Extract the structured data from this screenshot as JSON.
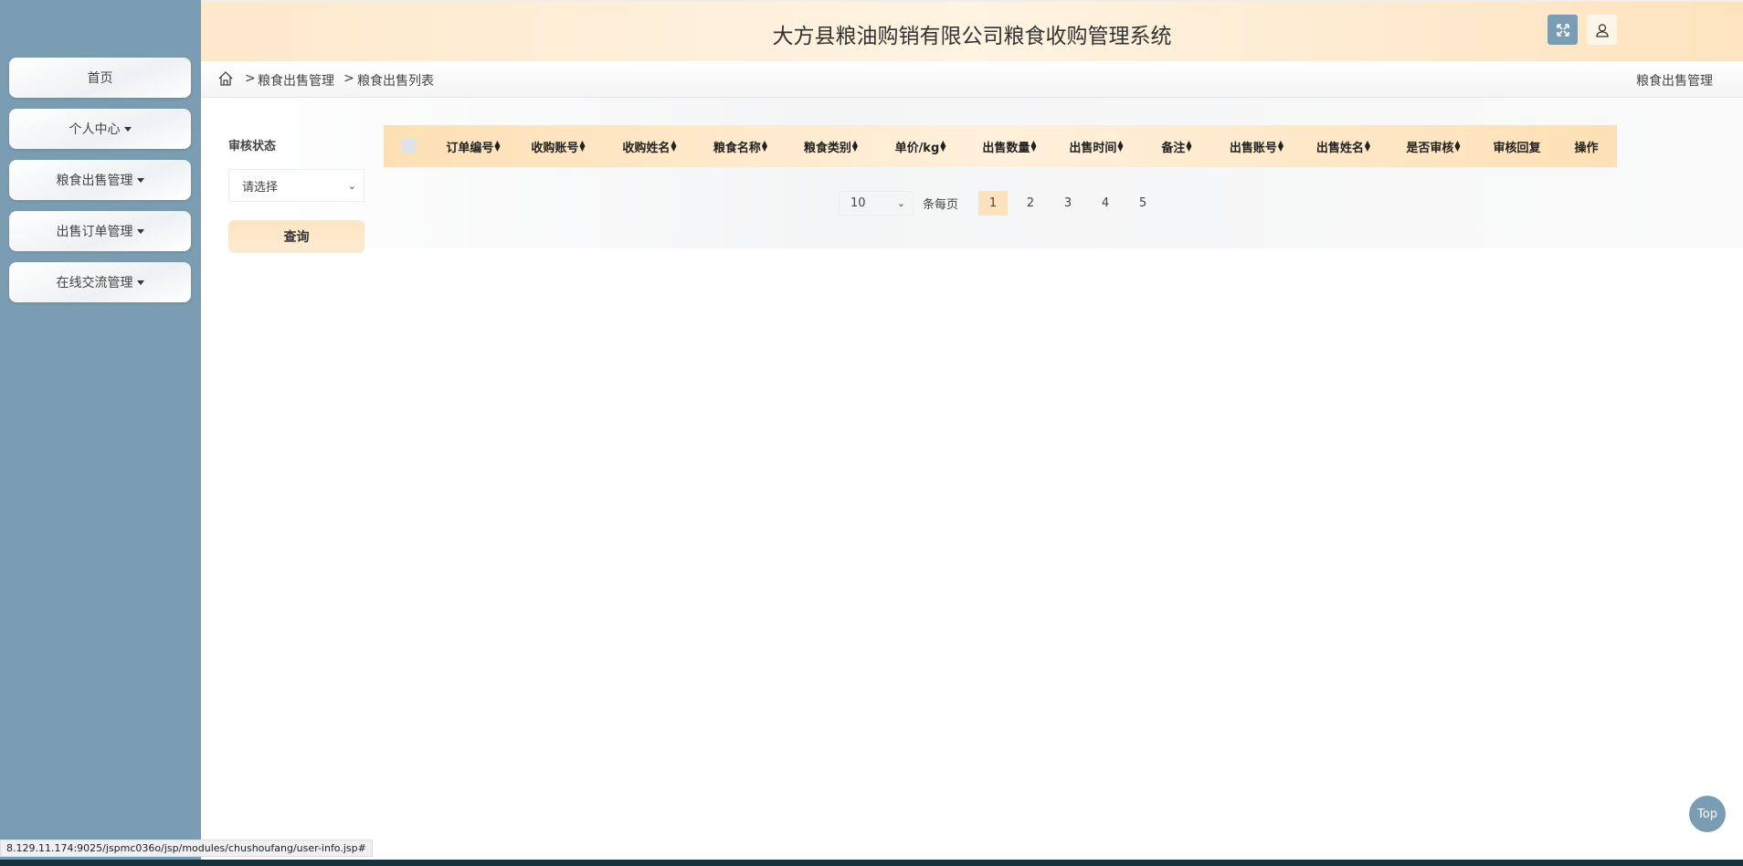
{
  "header": {
    "title": "大方县粮油购销有限公司粮食收购管理系统"
  },
  "sidebar": {
    "items": [
      {
        "label": "首页",
        "dropdown": false
      },
      {
        "label": "个人中心",
        "dropdown": true
      },
      {
        "label": "粮食出售管理",
        "dropdown": true
      },
      {
        "label": "出售订单管理",
        "dropdown": true
      },
      {
        "label": "在线交流管理",
        "dropdown": true
      }
    ]
  },
  "breadcrumb": {
    "items": [
      "粮食出售管理",
      "粮食出售列表"
    ],
    "sep": ">",
    "right": "粮食出售管理"
  },
  "filter": {
    "label": "审核状态",
    "select_value": "请选择",
    "query_label": "查询"
  },
  "table": {
    "columns": [
      {
        "label": "订单编号",
        "sortable": true
      },
      {
        "label": "收购账号",
        "sortable": true
      },
      {
        "label": "收购姓名",
        "sortable": true
      },
      {
        "label": "粮食名称",
        "sortable": true
      },
      {
        "label": "粮食类别",
        "sortable": true
      },
      {
        "label": "单价/kg",
        "sortable": true
      },
      {
        "label": "出售数量",
        "sortable": true
      },
      {
        "label": "出售时间",
        "sortable": true
      },
      {
        "label": "备注",
        "sortable": true
      },
      {
        "label": "出售账号",
        "sortable": true
      },
      {
        "label": "出售姓名",
        "sortable": true
      },
      {
        "label": "是否审核",
        "sortable": true
      },
      {
        "label": "审核回复",
        "sortable": false
      },
      {
        "label": "操作",
        "sortable": false
      }
    ],
    "rows": []
  },
  "pagination": {
    "page_size": "10",
    "per_page_label": "条每页",
    "pages": [
      "1",
      "2",
      "3",
      "4",
      "5"
    ],
    "current": "1"
  },
  "top_button": "Top",
  "status_url": "8.129.11.174:9025/jspmc036o/jsp/modules/chushoufang/user-info.jsp#",
  "colors": {
    "sidebar": "#7b9db3",
    "accent": "#fde0b5"
  }
}
